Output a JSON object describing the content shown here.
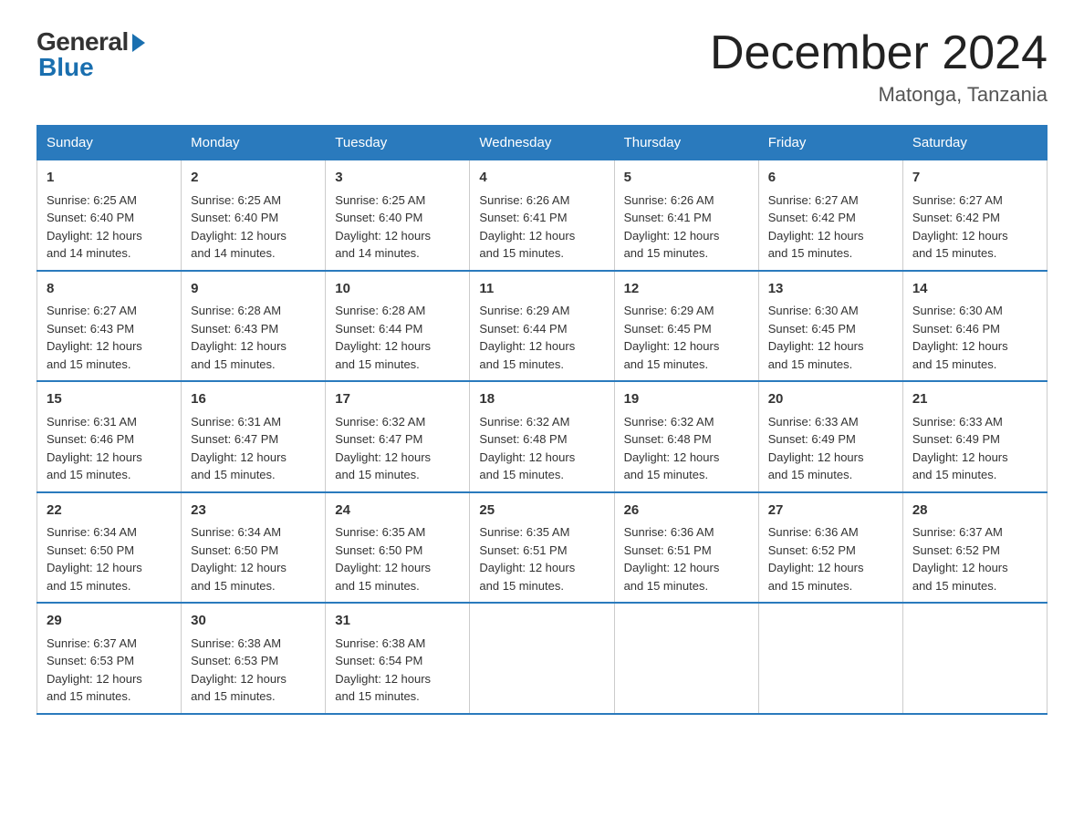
{
  "logo": {
    "general": "General",
    "blue": "Blue"
  },
  "title": "December 2024",
  "location": "Matonga, Tanzania",
  "days_of_week": [
    "Sunday",
    "Monday",
    "Tuesday",
    "Wednesday",
    "Thursday",
    "Friday",
    "Saturday"
  ],
  "weeks": [
    [
      {
        "day": "1",
        "sunrise": "6:25 AM",
        "sunset": "6:40 PM",
        "daylight": "12 hours and 14 minutes."
      },
      {
        "day": "2",
        "sunrise": "6:25 AM",
        "sunset": "6:40 PM",
        "daylight": "12 hours and 14 minutes."
      },
      {
        "day": "3",
        "sunrise": "6:25 AM",
        "sunset": "6:40 PM",
        "daylight": "12 hours and 14 minutes."
      },
      {
        "day": "4",
        "sunrise": "6:26 AM",
        "sunset": "6:41 PM",
        "daylight": "12 hours and 15 minutes."
      },
      {
        "day": "5",
        "sunrise": "6:26 AM",
        "sunset": "6:41 PM",
        "daylight": "12 hours and 15 minutes."
      },
      {
        "day": "6",
        "sunrise": "6:27 AM",
        "sunset": "6:42 PM",
        "daylight": "12 hours and 15 minutes."
      },
      {
        "day": "7",
        "sunrise": "6:27 AM",
        "sunset": "6:42 PM",
        "daylight": "12 hours and 15 minutes."
      }
    ],
    [
      {
        "day": "8",
        "sunrise": "6:27 AM",
        "sunset": "6:43 PM",
        "daylight": "12 hours and 15 minutes."
      },
      {
        "day": "9",
        "sunrise": "6:28 AM",
        "sunset": "6:43 PM",
        "daylight": "12 hours and 15 minutes."
      },
      {
        "day": "10",
        "sunrise": "6:28 AM",
        "sunset": "6:44 PM",
        "daylight": "12 hours and 15 minutes."
      },
      {
        "day": "11",
        "sunrise": "6:29 AM",
        "sunset": "6:44 PM",
        "daylight": "12 hours and 15 minutes."
      },
      {
        "day": "12",
        "sunrise": "6:29 AM",
        "sunset": "6:45 PM",
        "daylight": "12 hours and 15 minutes."
      },
      {
        "day": "13",
        "sunrise": "6:30 AM",
        "sunset": "6:45 PM",
        "daylight": "12 hours and 15 minutes."
      },
      {
        "day": "14",
        "sunrise": "6:30 AM",
        "sunset": "6:46 PM",
        "daylight": "12 hours and 15 minutes."
      }
    ],
    [
      {
        "day": "15",
        "sunrise": "6:31 AM",
        "sunset": "6:46 PM",
        "daylight": "12 hours and 15 minutes."
      },
      {
        "day": "16",
        "sunrise": "6:31 AM",
        "sunset": "6:47 PM",
        "daylight": "12 hours and 15 minutes."
      },
      {
        "day": "17",
        "sunrise": "6:32 AM",
        "sunset": "6:47 PM",
        "daylight": "12 hours and 15 minutes."
      },
      {
        "day": "18",
        "sunrise": "6:32 AM",
        "sunset": "6:48 PM",
        "daylight": "12 hours and 15 minutes."
      },
      {
        "day": "19",
        "sunrise": "6:32 AM",
        "sunset": "6:48 PM",
        "daylight": "12 hours and 15 minutes."
      },
      {
        "day": "20",
        "sunrise": "6:33 AM",
        "sunset": "6:49 PM",
        "daylight": "12 hours and 15 minutes."
      },
      {
        "day": "21",
        "sunrise": "6:33 AM",
        "sunset": "6:49 PM",
        "daylight": "12 hours and 15 minutes."
      }
    ],
    [
      {
        "day": "22",
        "sunrise": "6:34 AM",
        "sunset": "6:50 PM",
        "daylight": "12 hours and 15 minutes."
      },
      {
        "day": "23",
        "sunrise": "6:34 AM",
        "sunset": "6:50 PM",
        "daylight": "12 hours and 15 minutes."
      },
      {
        "day": "24",
        "sunrise": "6:35 AM",
        "sunset": "6:50 PM",
        "daylight": "12 hours and 15 minutes."
      },
      {
        "day": "25",
        "sunrise": "6:35 AM",
        "sunset": "6:51 PM",
        "daylight": "12 hours and 15 minutes."
      },
      {
        "day": "26",
        "sunrise": "6:36 AM",
        "sunset": "6:51 PM",
        "daylight": "12 hours and 15 minutes."
      },
      {
        "day": "27",
        "sunrise": "6:36 AM",
        "sunset": "6:52 PM",
        "daylight": "12 hours and 15 minutes."
      },
      {
        "day": "28",
        "sunrise": "6:37 AM",
        "sunset": "6:52 PM",
        "daylight": "12 hours and 15 minutes."
      }
    ],
    [
      {
        "day": "29",
        "sunrise": "6:37 AM",
        "sunset": "6:53 PM",
        "daylight": "12 hours and 15 minutes."
      },
      {
        "day": "30",
        "sunrise": "6:38 AM",
        "sunset": "6:53 PM",
        "daylight": "12 hours and 15 minutes."
      },
      {
        "day": "31",
        "sunrise": "6:38 AM",
        "sunset": "6:54 PM",
        "daylight": "12 hours and 15 minutes."
      },
      null,
      null,
      null,
      null
    ]
  ],
  "labels": {
    "sunrise": "Sunrise:",
    "sunset": "Sunset:",
    "daylight": "Daylight:"
  }
}
